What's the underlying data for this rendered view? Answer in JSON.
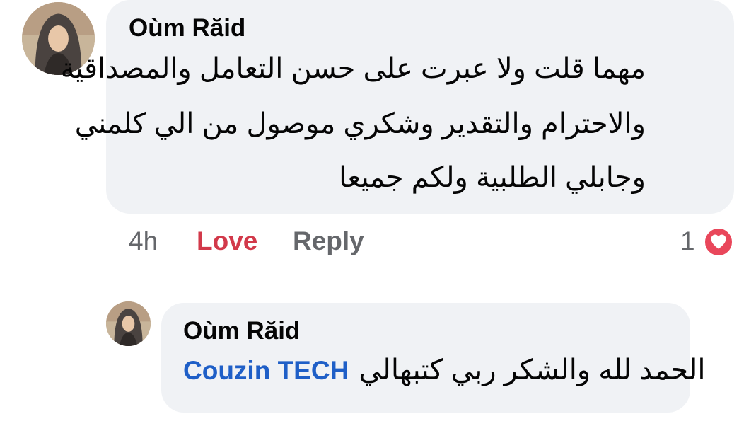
{
  "comment": {
    "author": "Oùm Răid",
    "avatar_icon": "avatar-woman-hijab-icon",
    "lines": [
      "مهما قلت ولا عبرت على حسن التعامل والمصداقية",
      "والاحترام والتقدير وشكري موصول من الي كلمني",
      "وجابلي الطلبية ولكم جميعا"
    ],
    "time": "4h",
    "love_label": "Love",
    "reply_label": "Reply",
    "reaction_count": "1",
    "reaction_icon": "love-reaction-icon",
    "reaction_color": "#e9475b"
  },
  "reply": {
    "author": "Oùm Răid",
    "avatar_icon": "avatar-woman-hijab-icon",
    "mention": "Couzin TECH",
    "text": "الحمد لله والشكر ربي كتبهالي"
  },
  "colors": {
    "bubble": "#f0f2f5",
    "mention": "#1f5fc7",
    "love": "#d2394a",
    "muted": "#65676b"
  }
}
